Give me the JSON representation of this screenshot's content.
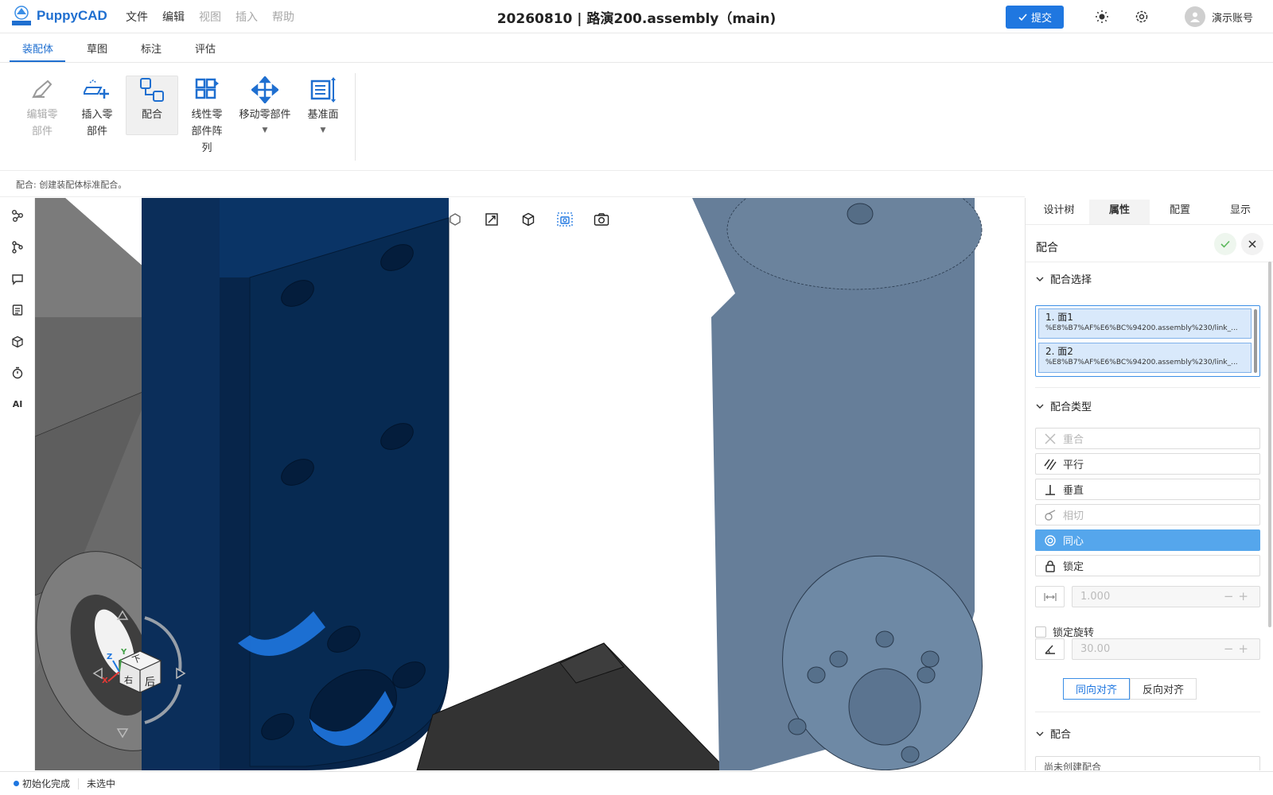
{
  "app": {
    "name": "PuppyCAD",
    "title": "20260810 | 路演200.assembly（main)"
  },
  "menu": {
    "file": "文件",
    "edit": "编辑",
    "view": "视图",
    "insert": "插入",
    "help": "帮助"
  },
  "header": {
    "submit": "提交",
    "user": "演示账号"
  },
  "tabs": [
    "装配体",
    "草图",
    "标注",
    "评估"
  ],
  "ribbon": {
    "edit_part": "编辑零\n部件",
    "insert_part": "插入零\n部件",
    "mate": "配合",
    "linear_pattern": "线性零\n部件阵\n列",
    "move_part": "移动零部件",
    "datum_plane": "基准面"
  },
  "hint": "配合: 创建装配体标准配合。",
  "left_sidebar": {
    "ai": "AI"
  },
  "view_cube": {
    "face_top": "下",
    "face_front": "后",
    "face_side": "右",
    "axis_x": "X",
    "axis_y": "Y",
    "axis_z": "Z"
  },
  "right_panel": {
    "tabs": [
      "设计树",
      "属性",
      "配置",
      "显示"
    ],
    "active_tab": "属性",
    "title": "配合",
    "section_select": "配合选择",
    "selections": [
      {
        "label": "1. 面1",
        "path": "%E8%B7%AF%E6%BC%94200.assembly%230/link_..."
      },
      {
        "label": "2. 面2",
        "path": "%E8%B7%AF%E6%BC%94200.assembly%230/link_..."
      }
    ],
    "section_type": "配合类型",
    "mate_types": {
      "coincident": "重合",
      "parallel": "平行",
      "perpendicular": "垂直",
      "tangent": "相切",
      "concentric": "同心",
      "lock": "锁定"
    },
    "distance_value": "1.000",
    "lock_rotation": "锁定旋转",
    "angle_value": "30.00",
    "align_same": "同向对齐",
    "align_opposite": "反向对齐",
    "section_mate": "配合",
    "mate_empty": "尚未创建配合"
  },
  "status": {
    "init": "初始化完成",
    "selection": "未选中"
  },
  "colors": {
    "accent": "#1f77e0",
    "dark_part": "#082c55",
    "light_part": "#667e99",
    "gray_part": "#7a7a7a"
  }
}
